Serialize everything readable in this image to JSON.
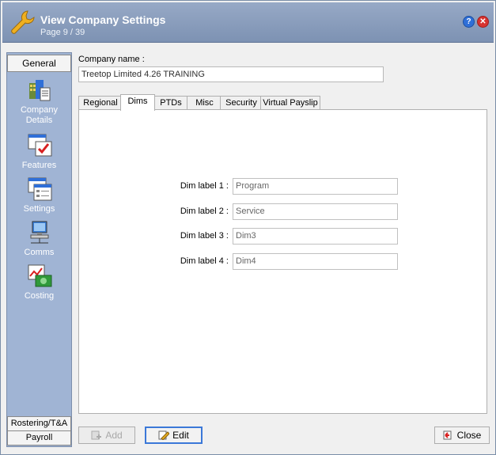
{
  "header": {
    "title": "View Company Settings",
    "subtitle": "Page 9 / 39",
    "help_icon": "?",
    "close_icon": "✕"
  },
  "nav": {
    "group_label": "General",
    "items": [
      {
        "label": "Company Details",
        "icon": "company-details-icon"
      },
      {
        "label": "Features",
        "icon": "features-icon"
      },
      {
        "label": "Settings",
        "icon": "settings-icon"
      },
      {
        "label": "Comms",
        "icon": "comms-icon"
      },
      {
        "label": "Costing",
        "icon": "costing-icon"
      }
    ],
    "footer_items": [
      "Rostering/T&A",
      "Payroll"
    ]
  },
  "company": {
    "label": "Company name :",
    "value": "Treetop Limited  4.26 TRAINING"
  },
  "tabs": [
    "Regional",
    "Dims",
    "PTDs",
    "Misc",
    "Security",
    "Virtual Payslip"
  ],
  "active_tab": "Dims",
  "dims": [
    {
      "label": "Dim label 1 :",
      "value": "Program"
    },
    {
      "label": "Dim label 2 :",
      "value": "Service"
    },
    {
      "label": "Dim label 3 :",
      "value": "Dim3"
    },
    {
      "label": "Dim label 4 :",
      "value": "Dim4"
    }
  ],
  "buttons": {
    "add": "Add",
    "edit": "Edit",
    "close": "Close"
  },
  "colors": {
    "header": "#8ea1c0",
    "nav": "#a0b4d4",
    "focus": "#3b78d8"
  }
}
